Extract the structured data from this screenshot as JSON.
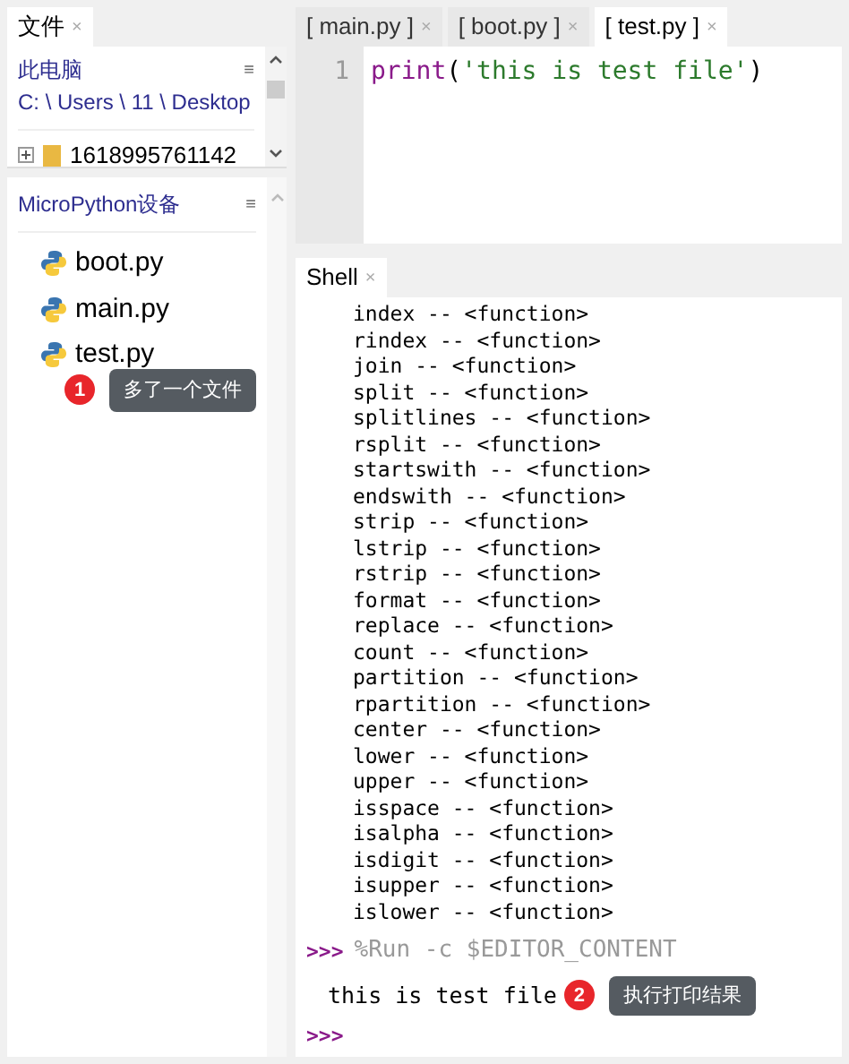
{
  "files_tab": {
    "label": "文件",
    "close": "×",
    "selected": true
  },
  "this_pc": {
    "title": "此电脑",
    "menu": "≡",
    "path": "C: \\ Users \\ 11 \\ Desktop",
    "items": [
      {
        "name": "1618995761142",
        "expanded": false
      }
    ]
  },
  "device": {
    "title": "MicroPython设备",
    "menu": "≡",
    "files": [
      {
        "name": "boot.py"
      },
      {
        "name": "main.py"
      },
      {
        "name": "test.py"
      }
    ]
  },
  "annotation_1": {
    "number": "1",
    "text": "多了一个文件"
  },
  "editor_tabs": [
    {
      "label": "[ main.py ]",
      "close": "×",
      "selected": false
    },
    {
      "label": "[ boot.py ]",
      "close": "×",
      "selected": false
    },
    {
      "label": "[ test.py ]",
      "close": "×",
      "selected": true
    }
  ],
  "editor": {
    "lines": [
      {
        "number": "1",
        "func": "print",
        "open": "(",
        "string": "'this is test file'",
        "close": ")"
      }
    ]
  },
  "shell_tab": {
    "label": "Shell",
    "close": "×",
    "selected": true
  },
  "shell": {
    "output": [
      "index -- <function>",
      "rindex -- <function>",
      "join -- <function>",
      "split -- <function>",
      "splitlines -- <function>",
      "rsplit -- <function>",
      "startswith -- <function>",
      "endswith -- <function>",
      "strip -- <function>",
      "lstrip -- <function>",
      "rstrip -- <function>",
      "format -- <function>",
      "replace -- <function>",
      "count -- <function>",
      "partition -- <function>",
      "rpartition -- <function>",
      "center -- <function>",
      "lower -- <function>",
      "upper -- <function>",
      "isspace -- <function>",
      "isalpha -- <function>",
      "isdigit -- <function>",
      "isupper -- <function>",
      "islower -- <function>"
    ],
    "prompt": ">>>",
    "command": "%Run -c $EDITOR_CONTENT",
    "result": "this is test file",
    "prompt_2": ">>>"
  },
  "annotation_2": {
    "number": "2",
    "text": "执行打印结果"
  }
}
